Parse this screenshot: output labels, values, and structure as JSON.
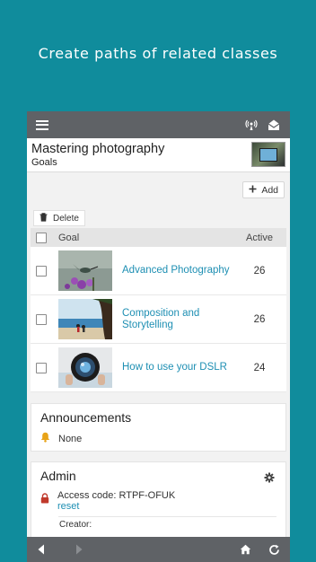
{
  "headline": "Create paths of related classes",
  "course": {
    "title": "Mastering photography",
    "subtitle": "Goals"
  },
  "toolbar": {
    "add_label": "Add",
    "delete_label": "Delete"
  },
  "table": {
    "columns": [
      "Goal",
      "Active"
    ],
    "rows": [
      {
        "name": "Advanced Photography",
        "active": "26",
        "image": "hummingbird-photo"
      },
      {
        "name": "Composition and Storytelling",
        "active": "26",
        "image": "beach-photo"
      },
      {
        "name": "How to use your DSLR",
        "active": "24",
        "image": "camera-lens-photo"
      }
    ]
  },
  "announcements": {
    "title": "Announcements",
    "value": "None"
  },
  "admin": {
    "title": "Admin",
    "access_code": "Access code: RTPF-OFUK",
    "reset_label": "reset",
    "creator_label": "Creator:"
  },
  "colors": {
    "background": "#108c9c",
    "bar": "#5f6266",
    "link": "#1e8fb3",
    "bell": "#e8a317",
    "lock": "#c0392b"
  },
  "icons": [
    "menu-icon",
    "broadcast-icon",
    "mail-open-icon",
    "plus-icon",
    "trash-icon",
    "bell-icon",
    "lock-icon",
    "gear-icon",
    "back-icon",
    "forward-icon",
    "home-icon",
    "refresh-icon"
  ]
}
